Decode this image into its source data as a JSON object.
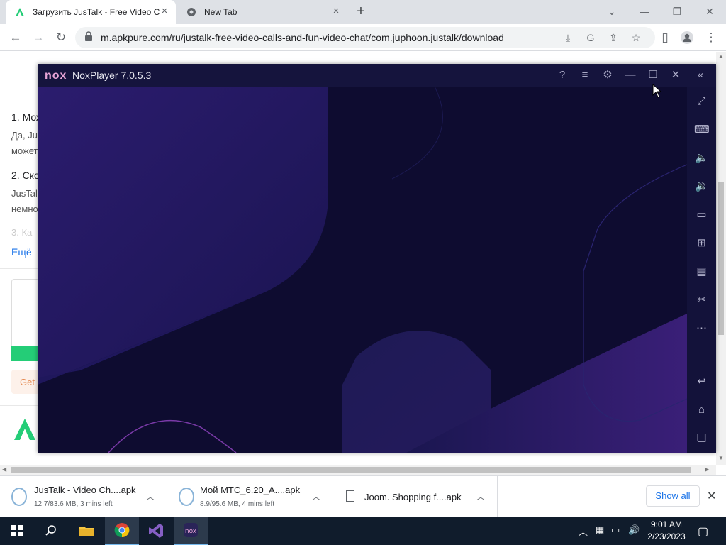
{
  "browser": {
    "tabs": [
      {
        "title": "Загрузить JusTalk - Free Video C",
        "active": true
      },
      {
        "title": "New Tab",
        "active": false
      }
    ],
    "url": "m.apkpure.com/ru/justalk-free-video-calls-and-fun-video-chat/com.juphoon.justalk/download"
  },
  "page": {
    "faq1": "1. Мож",
    "faq1_text_a": "Да, Jus",
    "faq1_text_b": "может",
    "faq2": "2. Ско",
    "faq2_text_a": "JusTal",
    "faq2_text_b": "немно",
    "faq3": "3. Ка",
    "more_link": "Ещё",
    "get_button": "Get"
  },
  "nox": {
    "logo": "nox",
    "title": "NoxPlayer 7.0.5.3"
  },
  "downloads": {
    "items": [
      {
        "name": "JusTalk - Video Ch....apk",
        "status": "12.7/83.6 MB, 3 mins left"
      },
      {
        "name": "Мой МТС_6.20_A....apk",
        "status": "8.9/95.6 MB, 4 mins left"
      },
      {
        "name": "Joom. Shopping f....apk",
        "status": ""
      }
    ],
    "show_all": "Show all"
  },
  "taskbar": {
    "time": "9:01 AM",
    "date": "2/23/2023"
  },
  "colors": {
    "nox_bg": "#13123a",
    "accent_green": "#24cd77",
    "link_blue": "#1a73e8"
  }
}
